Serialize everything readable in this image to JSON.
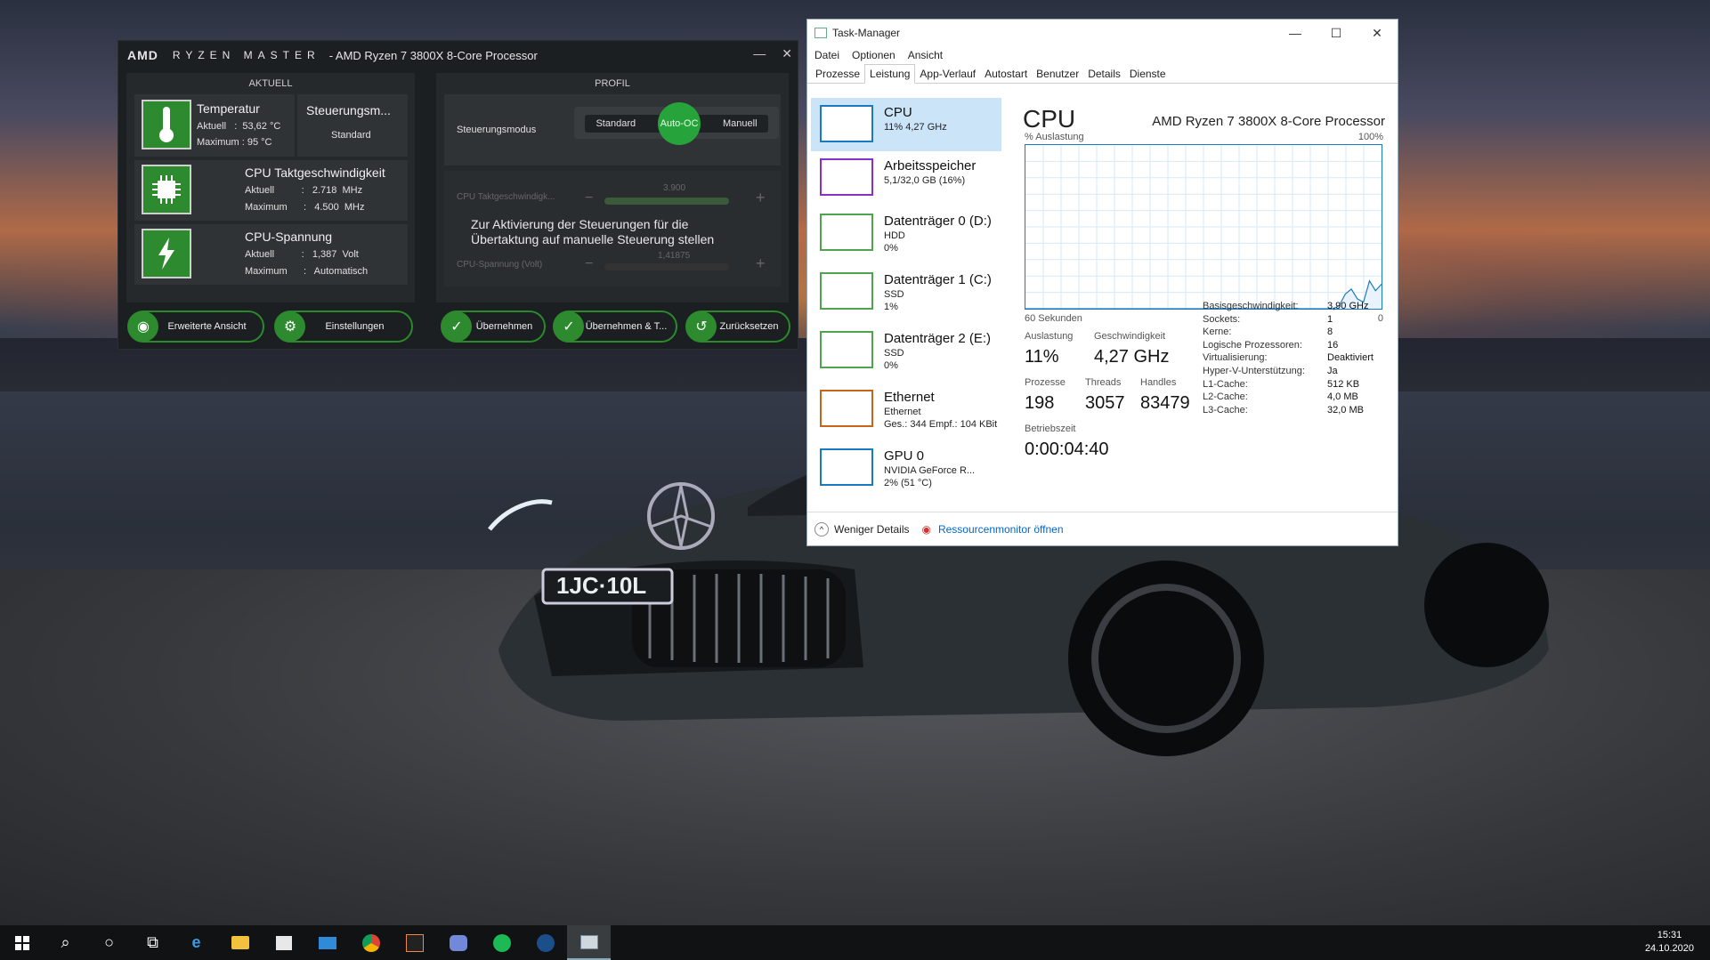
{
  "ryzen_master": {
    "logo": "AMD",
    "brand": "RYZEN MASTER",
    "title": "- AMD Ryzen 7 3800X 8-Core Processor",
    "section_current": "AKTUELL",
    "section_profile": "PROFIL",
    "temperature": {
      "title": "Temperatur",
      "current_label": "Aktuell",
      "current_value": "53,62 °C",
      "max_label": "Maximum",
      "max_value": "95 °C"
    },
    "control_mode_card": {
      "title": "Steuerungsm...",
      "value": "Standard"
    },
    "clock": {
      "title": "CPU Taktgeschwindigkeit",
      "current_label": "Aktuell",
      "current_value": "2.718  MHz",
      "max_label": "Maximum",
      "max_value": "4.500  MHz"
    },
    "voltage": {
      "title": "CPU-Spannung",
      "current_label": "Aktuell",
      "current_value": "1,387  Volt",
      "max_label": "Maximum",
      "max_value": "Automatisch"
    },
    "profile": {
      "mode_label": "Steuerungsmodus",
      "modes": [
        "Standard",
        "Auto-OC",
        "Manuell"
      ],
      "active_mode": "Auto-OC",
      "clock_slider_label": "CPU Taktgeschwindigk...",
      "clock_slider_value": "3.900",
      "voltage_slider_label": "CPU-Spannung (Volt)",
      "voltage_slider_value": "1,41875",
      "message": "Zur Aktivierung der Steuerungen für die Übertaktung auf manuelle Steuerung stellen"
    },
    "buttons": {
      "advanced": "Erweiterte Ansicht",
      "settings": "Einstellungen",
      "apply": "Übernehmen",
      "apply_test": "Übernehmen & T...",
      "reset": "Zurücksetzen"
    }
  },
  "task_manager": {
    "title": "Task-Manager",
    "menu": [
      "Datei",
      "Optionen",
      "Ansicht"
    ],
    "tabs": [
      "Prozesse",
      "Leistung",
      "App-Verlauf",
      "Autostart",
      "Benutzer",
      "Details",
      "Dienste"
    ],
    "active_tab": "Leistung",
    "sidebar": [
      {
        "name": "CPU",
        "sub1": "11%  4,27 GHz",
        "sub2": "",
        "sub3": "",
        "color": "#1a7abf"
      },
      {
        "name": "Arbeitsspeicher",
        "sub1": "5,1/32,0 GB (16%)",
        "sub2": "",
        "sub3": "",
        "color": "#8b2fc9"
      },
      {
        "name": "Datenträger 0 (D:)",
        "sub1": "HDD",
        "sub2": "0%",
        "sub3": "",
        "color": "#4da64d"
      },
      {
        "name": "Datenträger 1 (C:)",
        "sub1": "SSD",
        "sub2": "1%",
        "sub3": "",
        "color": "#4da64d"
      },
      {
        "name": "Datenträger 2 (E:)",
        "sub1": "SSD",
        "sub2": "0%",
        "sub3": "",
        "color": "#4da64d"
      },
      {
        "name": "Ethernet",
        "sub1": "Ethernet",
        "sub2": "Ges.: 344  Empf.: 104 KBit",
        "sub3": "",
        "color": "#c8651b"
      },
      {
        "name": "GPU 0",
        "sub1": "NVIDIA GeForce R...",
        "sub2": "2% (51 °C)",
        "sub3": "",
        "color": "#1a7abf"
      }
    ],
    "cpu_heading": "CPU",
    "processor": "AMD Ryzen 7 3800X 8-Core Processor",
    "graph_top_left": "% Auslastung",
    "graph_top_right": "100%",
    "graph_bottom_left": "60 Sekunden",
    "graph_bottom_right": "0",
    "usage_graph": [
      0,
      0,
      0,
      0,
      0,
      0,
      0,
      0,
      0,
      0,
      0,
      0,
      0,
      0,
      0,
      0,
      0,
      0,
      0,
      0,
      0,
      0,
      0,
      0,
      0,
      0,
      0,
      0,
      0,
      0,
      0,
      0,
      0,
      0,
      0,
      0,
      0,
      0,
      0,
      0,
      0,
      0,
      0,
      0,
      0,
      0,
      0,
      0,
      0,
      0,
      0,
      0,
      2,
      9,
      12,
      6,
      4,
      17,
      11,
      15
    ],
    "stats": {
      "usage_label": "Auslastung",
      "usage_value": "11%",
      "speed_label": "Geschwindigkeit",
      "speed_value": "4,27 GHz",
      "processes_label": "Prozesse",
      "processes_value": "198",
      "threads_label": "Threads",
      "threads_value": "3057",
      "handles_label": "Handles",
      "handles_value": "83479",
      "uptime_label": "Betriebszeit",
      "uptime_value": "0:00:04:40"
    },
    "specs": [
      {
        "k": "Basisgeschwindigkeit:",
        "v": "3,90 GHz"
      },
      {
        "k": "Sockets:",
        "v": "1"
      },
      {
        "k": "Kerne:",
        "v": "8"
      },
      {
        "k": "Logische Prozessoren:",
        "v": "16"
      },
      {
        "k": "Virtualisierung:",
        "v": "Deaktiviert"
      },
      {
        "k": "Hyper-V-Unterstützung:",
        "v": "Ja"
      },
      {
        "k": "L1-Cache:",
        "v": "512 KB"
      },
      {
        "k": "L2-Cache:",
        "v": "4,0 MB"
      },
      {
        "k": "L3-Cache:",
        "v": "32,0 MB"
      }
    ],
    "footer_less": "Weniger Details",
    "footer_link": "Ressourcenmonitor öffnen"
  },
  "wallpaper": {
    "plate": "1JC·10L"
  },
  "taskbar": {
    "icons": [
      "windows-start-icon",
      "search-icon",
      "cortana-icon",
      "task-view-icon",
      "edge-icon",
      "file-explorer-icon",
      "store-icon",
      "mail-icon",
      "chrome-icon",
      "ryzen-master-icon",
      "discord-icon",
      "spotify-icon",
      "steam-icon",
      "task-manager-icon"
    ],
    "time": "15:31",
    "date": "24.10.2020"
  }
}
